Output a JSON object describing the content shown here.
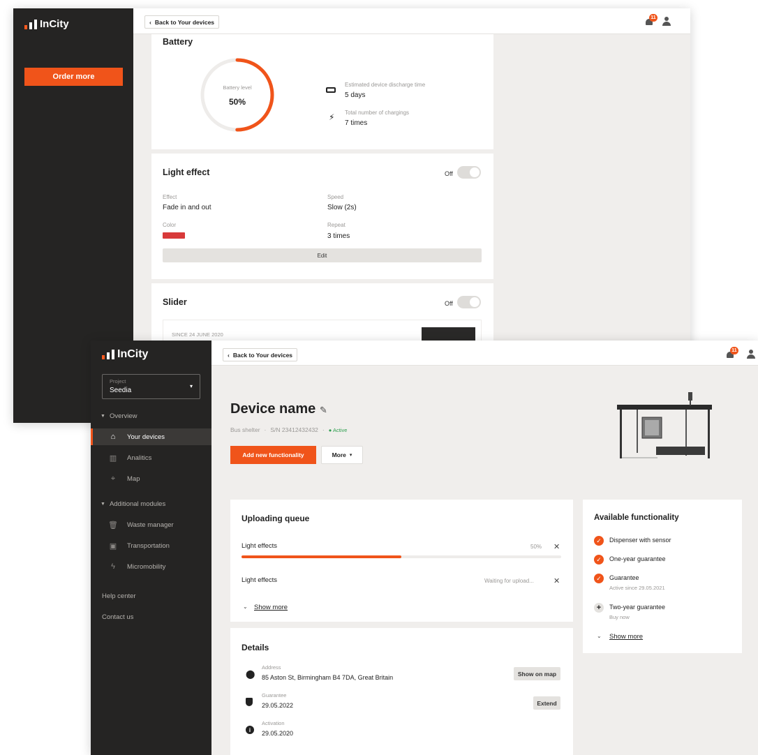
{
  "brand": {
    "name": "InCity"
  },
  "back_window": {
    "sidebar": {
      "order_button": "Order more"
    },
    "header": {
      "back_label": "Back to Your devices",
      "notification_count": "11"
    },
    "battery": {
      "title": "Battery",
      "gauge_label": "Battery level",
      "gauge_value": "50%",
      "level_fraction": 0.5,
      "discharge_label": "Estimated device discharge time",
      "discharge_value": "5 days",
      "chargings_label": "Total number of chargings",
      "chargings_value": "7 times"
    },
    "light_effect": {
      "title": "Light effect",
      "toggle_label": "Off",
      "effect_label": "Effect",
      "effect_value": "Fade in and out",
      "speed_label": "Speed",
      "speed_value": "Slow (2s)",
      "color_label": "Color",
      "color_value": "#d83a3a",
      "repeat_label": "Repeat",
      "repeat_value": "3 times",
      "edit_button": "Edit"
    },
    "slider": {
      "title": "Slider",
      "toggle_label": "Off",
      "since_label": "SINCE 24 JUNE 2020"
    }
  },
  "front_window": {
    "header": {
      "back_label": "Back to Your devices",
      "notification_count": "11"
    },
    "sidebar": {
      "project_label": "Project",
      "project_value": "Seedia",
      "overview_label": "Overview",
      "nav": [
        {
          "label": "Your devices",
          "icon": "home-icon"
        },
        {
          "label": "Analitics",
          "icon": "analytics-icon"
        },
        {
          "label": "Map",
          "icon": "map-icon"
        }
      ],
      "modules_label": "Additional modules",
      "modules": [
        {
          "label": "Waste manager",
          "icon": "trash-icon"
        },
        {
          "label": "Transportation",
          "icon": "bus-icon"
        },
        {
          "label": "Micromobility",
          "icon": "bolt-icon"
        }
      ],
      "help_label": "Help center",
      "contact_label": "Contact us"
    },
    "device": {
      "name": "Device name",
      "type": "Bus shelter",
      "serial": "S/N 23412432432",
      "status": "Active",
      "add_button": "Add new functionality",
      "more_button": "More"
    },
    "queue": {
      "title": "Uploading queue",
      "items": [
        {
          "label": "Light effects",
          "status": "50%",
          "progress": 0.5
        },
        {
          "label": "Light effects",
          "status": "Waiting for upload...",
          "progress": 0
        }
      ],
      "show_more": "Show more"
    },
    "details": {
      "title": "Details",
      "address_label": "Address",
      "address_value": "85 Aston St, Birmingham B4 7DA, Great Britain",
      "map_button": "Show on map",
      "guarantee_label": "Guarantee",
      "guarantee_value": "29.05.2022",
      "extend_button": "Extend",
      "activation_label": "Activation",
      "activation_value": "29.05.2020"
    },
    "functionality": {
      "title": "Available functionality",
      "items": [
        {
          "label": "Dispenser with sensor",
          "sub": "",
          "active": true
        },
        {
          "label": "One-year guarantee",
          "sub": "",
          "active": true
        },
        {
          "label": "Guarantee",
          "sub": "Active since 29.05.2021",
          "active": true
        },
        {
          "label": "Two-year guarantee",
          "sub": "Buy now",
          "active": false
        }
      ],
      "show_more": "Show more"
    },
    "colors": {
      "accent": "#f0541a",
      "sidebar": "#252423",
      "active_status": "#2e9e4f"
    }
  }
}
